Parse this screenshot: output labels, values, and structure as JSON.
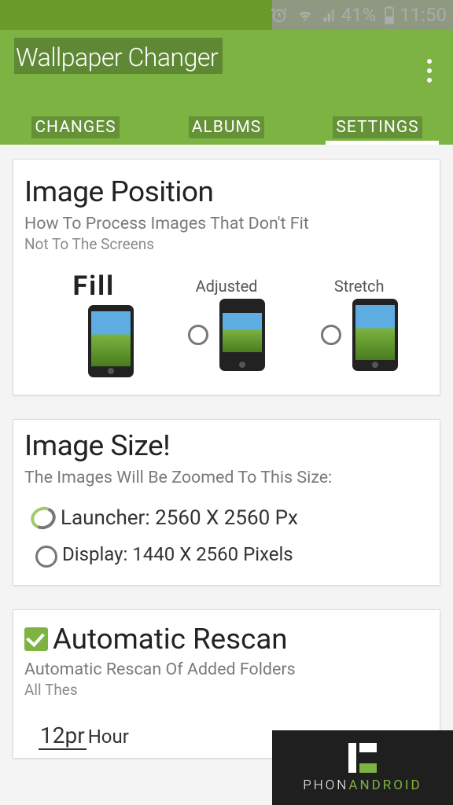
{
  "statusbar": {
    "battery": "41%",
    "time": "11:50"
  },
  "app": {
    "title": "Wallpaper Changer"
  },
  "tabs": {
    "changes": "CHANGES",
    "albums": "ALBUMS",
    "settings": "SETTINGS"
  },
  "imagePosition": {
    "title": "Image Position",
    "subtitle": "How To Process Images That Don't Fit",
    "subtitle2": "Not To The Screens",
    "options": {
      "fill": "Fill",
      "adjusted": "Adjusted",
      "stretch": "Stretch"
    }
  },
  "imageSize": {
    "title": "Image Size!",
    "subtitle": "The Images Will Be Zoomed To This Size:",
    "launcher": "Launcher: 2560 X 2560 Px",
    "display": "Display: 1440 X 2560 Pixels"
  },
  "autoRescan": {
    "title": "Automatic Rescan",
    "subtitle": "Automatic Rescan Of Added Folders",
    "subtitle2": "All Thes",
    "intervalNum": "12pr",
    "intervalUnit": "Hour"
  },
  "watermark": {
    "text1": "PHON",
    "text2": "ANDROID"
  }
}
